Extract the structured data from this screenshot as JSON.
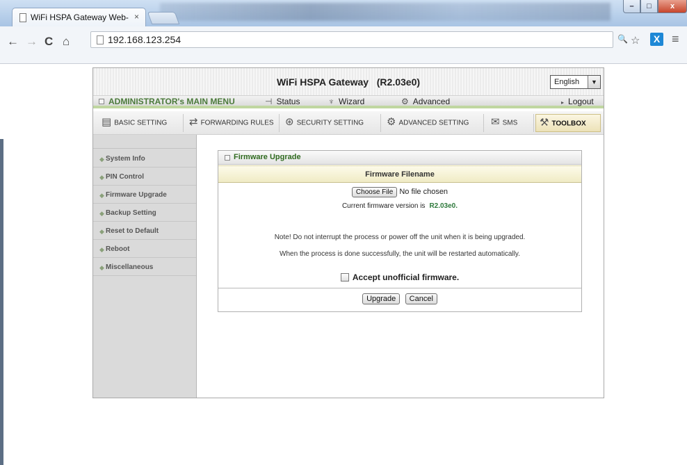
{
  "browser": {
    "tab_title": "WiFi HSPA Gateway Web-",
    "tab_close": "×",
    "url": "192.168.123.254",
    "win_min": "–",
    "win_max": "□",
    "win_close": "x",
    "back": "←",
    "forward": "→",
    "reload": "C",
    "home": "⌂",
    "zoom": "🔍",
    "star": "☆",
    "ext": "X",
    "menu": "≡"
  },
  "header": {
    "title": "WiFi HSPA Gateway   (R2.03e0)",
    "language": "English"
  },
  "menubar": {
    "admin": "ADMINISTRATOR's MAIN MENU",
    "status": "Status",
    "wizard": "Wizard",
    "advanced": "Advanced",
    "logout": "Logout"
  },
  "tabs": {
    "basic": "BASIC SETTING",
    "forwarding": "FORWARDING RULES",
    "security": "SECURITY SETTING",
    "advanced": "ADVANCED SETTING",
    "sms": "SMS",
    "toolbox": "TOOLBOX"
  },
  "sidebar": {
    "items": [
      {
        "label": "System Info"
      },
      {
        "label": "PIN Control"
      },
      {
        "label": "Firmware Upgrade"
      },
      {
        "label": "Backup Setting"
      },
      {
        "label": "Reset to Default"
      },
      {
        "label": "Reboot"
      },
      {
        "label": "Miscellaneous"
      }
    ]
  },
  "panel": {
    "title": "Firmware Upgrade",
    "column_header": "Firmware Filename",
    "choose_file": "Choose File",
    "no_file": "No file chosen",
    "version_text": "Current firmware version is",
    "version": "R2.03e0.",
    "note1": "Note! Do not interrupt the process or power off the unit when it is being upgraded.",
    "note2": "When the process is done successfully, the unit will be restarted automatically.",
    "accept": "Accept unofficial firmware.",
    "upgrade": "Upgrade",
    "cancel": "Cancel"
  }
}
